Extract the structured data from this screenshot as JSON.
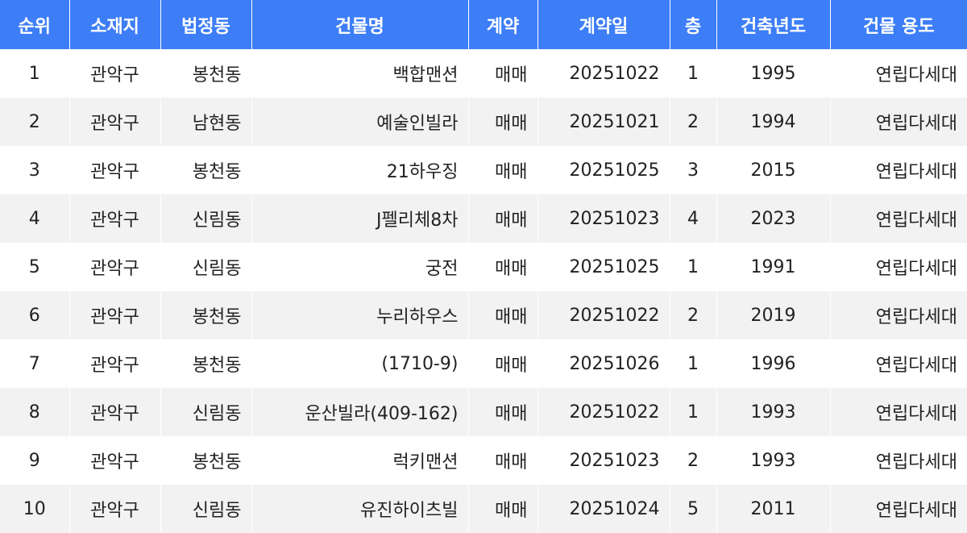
{
  "colors": {
    "header_bg": "#3d7ef7",
    "header_text": "#ffffff",
    "row_alt_bg": "#f2f2f2",
    "row_bg": "#ffffff",
    "text": "#222222"
  },
  "table": {
    "headers": [
      "순위",
      "소재지",
      "법정동",
      "건물명",
      "계약",
      "계약일",
      "층",
      "건축년도",
      "건물 용도"
    ],
    "rows": [
      [
        "1",
        "관악구",
        "봉천동",
        "백합맨션",
        "매매",
        "20251022",
        "1",
        "1995",
        "연립다세대"
      ],
      [
        "2",
        "관악구",
        "남현동",
        "예술인빌라",
        "매매",
        "20251021",
        "2",
        "1994",
        "연립다세대"
      ],
      [
        "3",
        "관악구",
        "봉천동",
        "21하우징",
        "매매",
        "20251025",
        "3",
        "2015",
        "연립다세대"
      ],
      [
        "4",
        "관악구",
        "신림동",
        "J펠리체8차",
        "매매",
        "20251023",
        "4",
        "2023",
        "연립다세대"
      ],
      [
        "5",
        "관악구",
        "신림동",
        "궁전",
        "매매",
        "20251025",
        "1",
        "1991",
        "연립다세대"
      ],
      [
        "6",
        "관악구",
        "봉천동",
        "누리하우스",
        "매매",
        "20251022",
        "2",
        "2019",
        "연립다세대"
      ],
      [
        "7",
        "관악구",
        "봉천동",
        "(1710-9)",
        "매매",
        "20251026",
        "1",
        "1996",
        "연립다세대"
      ],
      [
        "8",
        "관악구",
        "신림동",
        "운산빌라(409-162)",
        "매매",
        "20251022",
        "1",
        "1993",
        "연립다세대"
      ],
      [
        "9",
        "관악구",
        "봉천동",
        "럭키맨션",
        "매매",
        "20251023",
        "2",
        "1993",
        "연립다세대"
      ],
      [
        "10",
        "관악구",
        "신림동",
        "유진하이츠빌",
        "매매",
        "20251024",
        "5",
        "2011",
        "연립다세대"
      ]
    ]
  }
}
